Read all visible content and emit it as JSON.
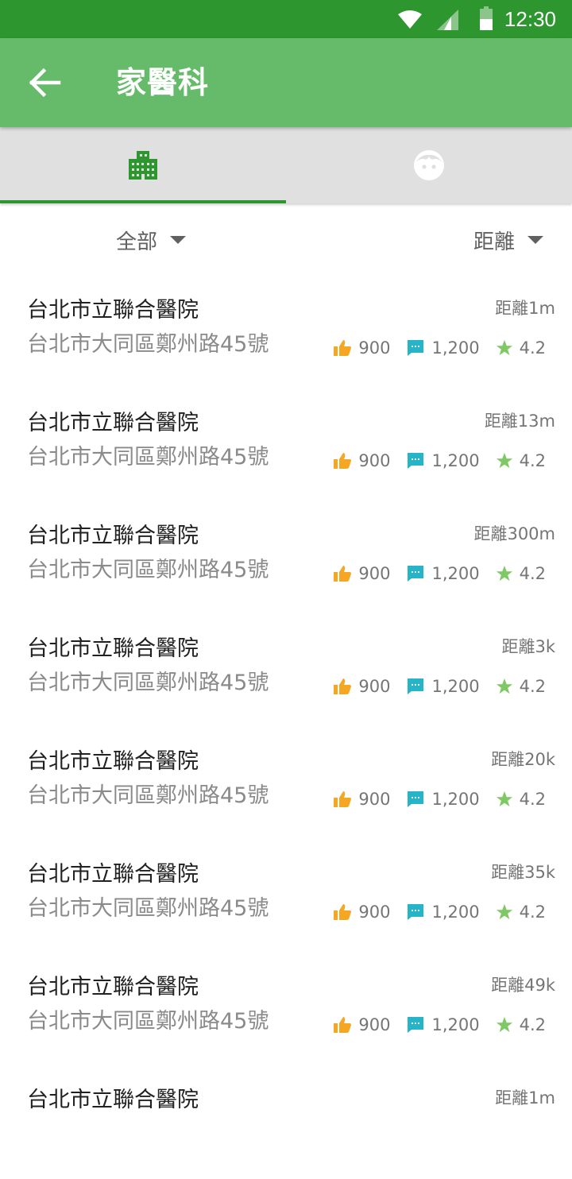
{
  "status_bar": {
    "time": "12:30"
  },
  "app_bar": {
    "title": "家醫科"
  },
  "filters": {
    "category": "全部",
    "sort": "距離"
  },
  "colors": {
    "primary_dark": "#2e962e",
    "primary": "#66bb6a",
    "like": "#f5a623",
    "comment": "#26b5c8",
    "star": "#7ec865"
  },
  "items": [
    {
      "name": "台北市立聯合醫院",
      "address": "台北市大同區鄭州路45號",
      "distance": "距離1m",
      "likes": "900",
      "comments": "1,200",
      "rating": "4.2"
    },
    {
      "name": "台北市立聯合醫院",
      "address": "台北市大同區鄭州路45號",
      "distance": "距離13m",
      "likes": "900",
      "comments": "1,200",
      "rating": "4.2"
    },
    {
      "name": "台北市立聯合醫院",
      "address": "台北市大同區鄭州路45號",
      "distance": "距離300m",
      "likes": "900",
      "comments": "1,200",
      "rating": "4.2"
    },
    {
      "name": "台北市立聯合醫院",
      "address": "台北市大同區鄭州路45號",
      "distance": "距離3k",
      "likes": "900",
      "comments": "1,200",
      "rating": "4.2"
    },
    {
      "name": "台北市立聯合醫院",
      "address": "台北市大同區鄭州路45號",
      "distance": "距離20k",
      "likes": "900",
      "comments": "1,200",
      "rating": "4.2"
    },
    {
      "name": "台北市立聯合醫院",
      "address": "台北市大同區鄭州路45號",
      "distance": "距離35k",
      "likes": "900",
      "comments": "1,200",
      "rating": "4.2"
    },
    {
      "name": "台北市立聯合醫院",
      "address": "台北市大同區鄭州路45號",
      "distance": "距離49k",
      "likes": "900",
      "comments": "1,200",
      "rating": "4.2"
    },
    {
      "name": "台北市立聯合醫院",
      "address": "",
      "distance": "距離1m",
      "likes": "",
      "comments": "",
      "rating": ""
    }
  ]
}
